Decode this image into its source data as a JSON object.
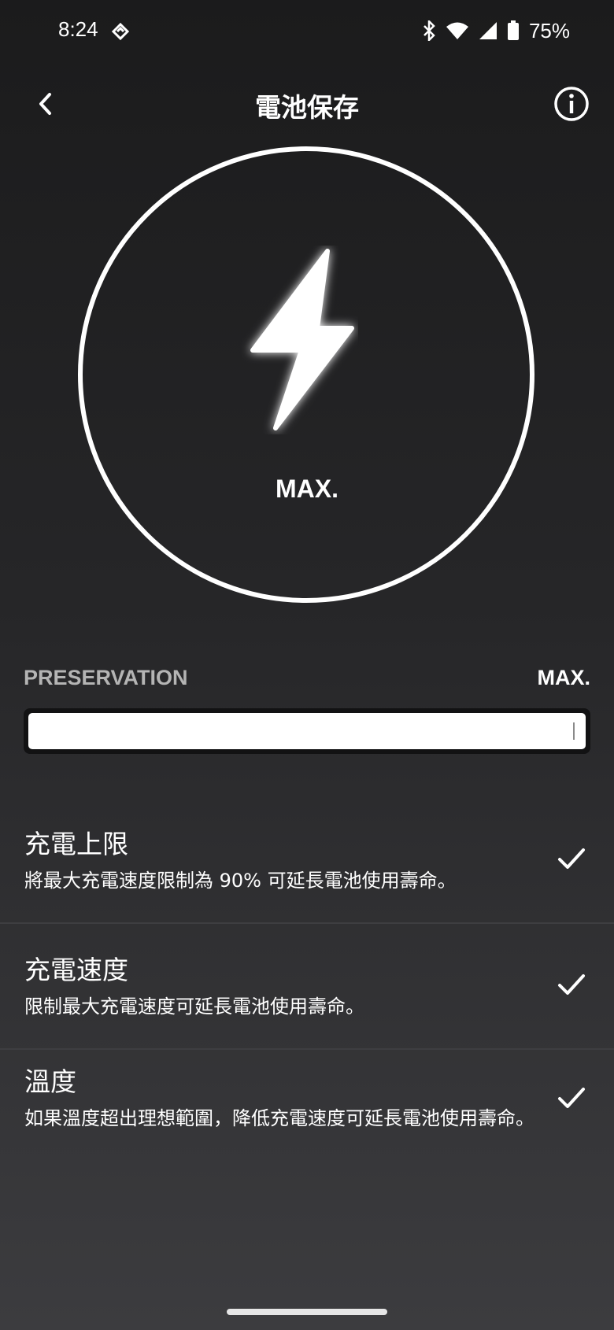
{
  "status_bar": {
    "time": "8:24",
    "battery_percent": "75%",
    "icons": [
      "app-notification-icon",
      "bluetooth-icon",
      "wifi-icon",
      "signal-icon",
      "battery-icon"
    ]
  },
  "header": {
    "title": "電池保存",
    "back_icon": "chevron-left-icon",
    "info_icon": "info-icon"
  },
  "gauge": {
    "icon": "lightning-bolt-icon",
    "mode_label": "MAX."
  },
  "slider": {
    "min_label": "PRESERVATION",
    "max_label": "MAX.",
    "value_fraction": 1.0
  },
  "options": [
    {
      "title": "充電上限",
      "description": "將最大充電速度限制為 90% 可延長電池使用壽命。",
      "checked": true
    },
    {
      "title": "充電速度",
      "description": "限制最大充電速度可延長電池使用壽命。",
      "checked": true
    },
    {
      "title": "溫度",
      "description": "如果溫度超出理想範圍，降低充電速度可延長電池使用壽命。",
      "checked": true
    }
  ],
  "colors": {
    "background_top": "#1b1b1c",
    "background_bottom": "#3c3c3f",
    "accent": "#ffffff",
    "muted_label": "#b4b4b4"
  }
}
